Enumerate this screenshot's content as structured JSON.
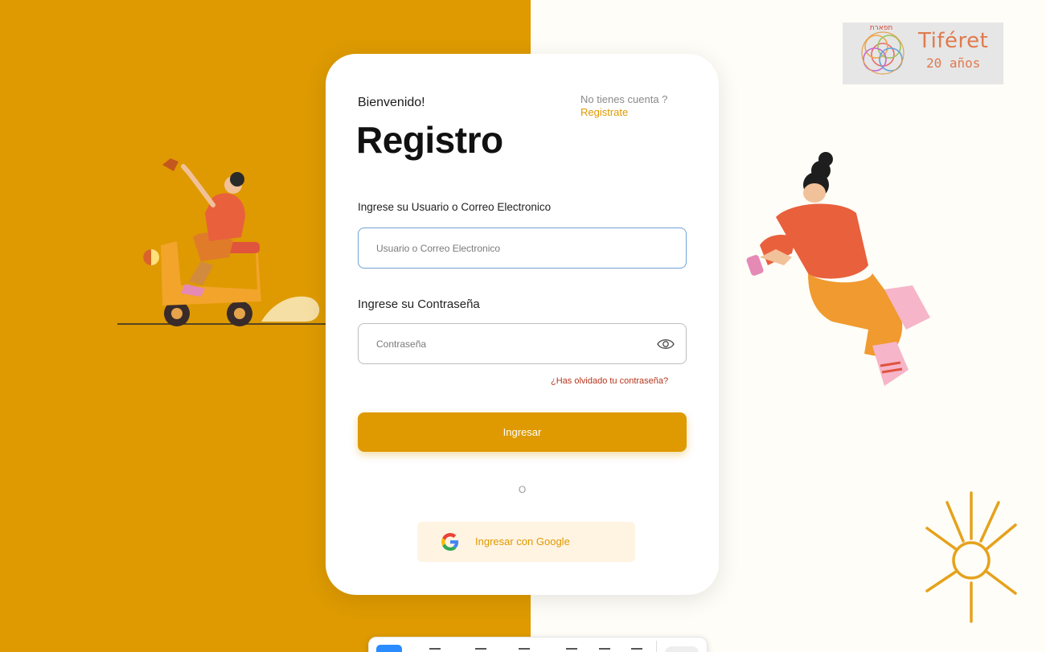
{
  "logo": {
    "name": "Tiféret",
    "subtitle": "20 años",
    "hebrew": "תפארת"
  },
  "card": {
    "greeting": "Bienvenido!",
    "title": "Registro",
    "no_account": "No tienes cuenta ?",
    "signup_link": "Registrate",
    "user_label": "Ingrese su Usuario o Correo Electronico",
    "user_placeholder": "Usuario o Correo Electronico",
    "password_label": "Ingrese su Contraseña",
    "password_placeholder": "Contraseña",
    "forgot_link": "¿Has olvidado tu contraseña?",
    "login_button": "Ingresar",
    "or_text": "O",
    "google_button": "Ingresar con Google"
  },
  "colors": {
    "brand": "#DE9A00",
    "background_light": "#FEFDF7",
    "card": "#FFFFFF",
    "link_red": "#B5351D",
    "focus_border": "#6FA2D6"
  },
  "icons": {
    "password_toggle": "eye-icon",
    "google": "google-icon"
  }
}
